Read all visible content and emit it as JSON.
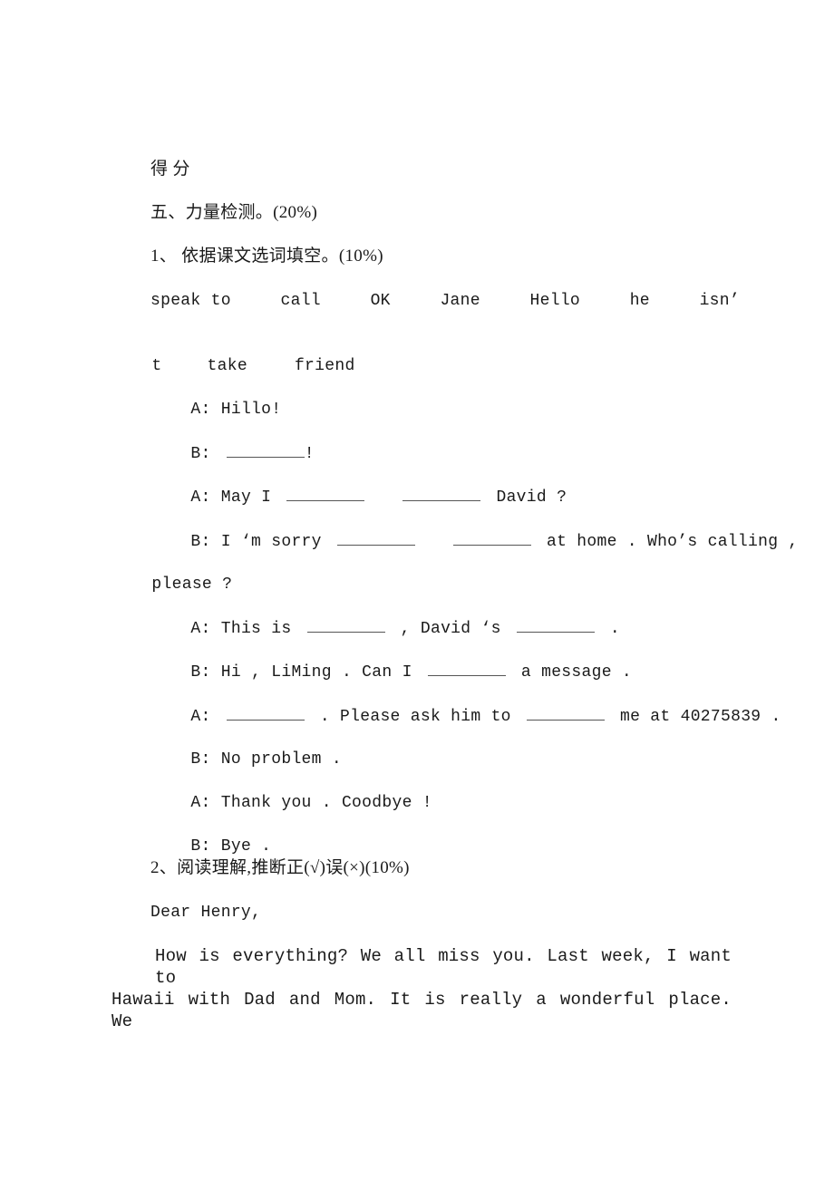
{
  "document": {
    "score_label": "得 分",
    "section_title": "五、力量检测。(20%)",
    "q1": {
      "title": "1、 依据课文选词填空。(10%)",
      "word_bank": [
        "speak to",
        "call",
        "OK",
        "Jane",
        "Hello",
        "he",
        "isn’"
      ],
      "word_bank_cont": [
        "t",
        "take",
        "friend"
      ],
      "dialogue": [
        {
          "speaker": "A:",
          "parts": [
            "Hillo!"
          ]
        },
        {
          "speaker": "B:",
          "parts": [
            "",
            "!"
          ]
        },
        {
          "speaker": "A:",
          "parts": [
            "May I",
            "",
            "",
            "David ?"
          ]
        },
        {
          "speaker": "B:",
          "parts": [
            "I ‘m sorry",
            "",
            "",
            "at home . Who’s calling ,"
          ]
        },
        {
          "speaker": "",
          "parts": [
            "please ?"
          ]
        },
        {
          "speaker": "A:",
          "parts": [
            "This is",
            "",
            ", David ‘s",
            "",
            "."
          ]
        },
        {
          "speaker": "B:",
          "parts": [
            "Hi , LiMing . Can I",
            "",
            "a message ."
          ]
        },
        {
          "speaker": "A:",
          "parts": [
            "",
            ". Please ask him to",
            "",
            "me at 40275839 ."
          ]
        },
        {
          "speaker": "B:",
          "parts": [
            "No problem ."
          ]
        },
        {
          "speaker": "A:",
          "parts": [
            "Thank you . Coodbye !"
          ]
        },
        {
          "speaker": "B:",
          "parts": [
            "Bye ."
          ]
        }
      ]
    },
    "q2": {
      "title": "2、阅读理解,推断正(√)误(×)(10%)",
      "salutation": "Dear Henry,",
      "para_line1": "How is everything? We all miss you. Last week, I want to",
      "para_line2": "Hawaii with Dad and Mom. It is really a wonderful place. We"
    }
  }
}
